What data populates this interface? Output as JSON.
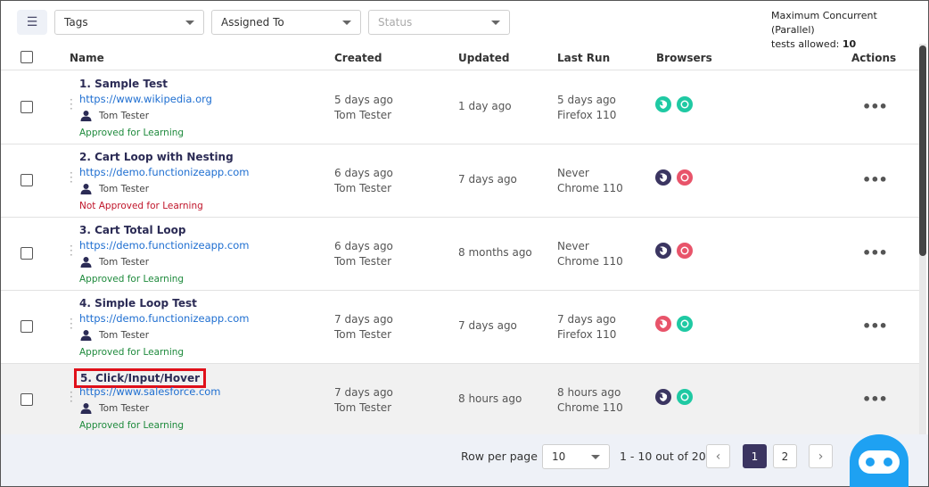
{
  "filters": {
    "tags": "Tags",
    "assigned_to": "Assigned To",
    "status": "Status"
  },
  "max_concurrent": {
    "line1": "Maximum Concurrent (Parallel)",
    "line2_prefix": "tests allowed: ",
    "value": "10"
  },
  "columns": {
    "name": "Name",
    "created": "Created",
    "updated": "Updated",
    "last_run": "Last Run",
    "browsers": "Browsers",
    "actions": "Actions"
  },
  "rows": [
    {
      "name": "1. Sample Test",
      "url": "https://www.wikipedia.org",
      "user": "Tom Tester",
      "status": "Approved for Learning",
      "created": "5 days ago",
      "created_by": "Tom Tester",
      "updated": "1 day ago",
      "last_run": "5 days ago",
      "last_run_browser": "Firefox 110",
      "browsers": [
        "firefox-green-icon",
        "chrome-green-icon"
      ]
    },
    {
      "name": "2. Cart Loop with Nesting",
      "url": "https://demo.functionizeapp.com",
      "user": "Tom Tester",
      "status": "Not Approved for Learning",
      "created": "6 days ago",
      "created_by": "Tom Tester",
      "updated": "7 days ago",
      "last_run": "Never",
      "last_run_browser": "Chrome 110",
      "browsers": [
        "firefox-purple-icon",
        "chrome-red-icon"
      ]
    },
    {
      "name": "3. Cart Total Loop",
      "url": "https://demo.functionizeapp.com",
      "user": "Tom Tester",
      "status": "Approved for Learning",
      "created": "6 days ago",
      "created_by": "Tom Tester",
      "updated": "8 months ago",
      "last_run": "Never",
      "last_run_browser": "Chrome 110",
      "browsers": [
        "firefox-purple-icon",
        "chrome-red-icon"
      ]
    },
    {
      "name": "4. Simple Loop Test",
      "url": "https://demo.functionizeapp.com",
      "user": "Tom Tester",
      "status": "Approved for Learning",
      "created": "7 days ago",
      "created_by": "Tom Tester",
      "updated": "7 days ago",
      "last_run": "7 days ago",
      "last_run_browser": "Firefox 110",
      "browsers": [
        "firefox-red-icon",
        "chrome-green-icon"
      ]
    },
    {
      "name": "5. Click/Input/Hover",
      "url": "https://www.salesforce.com",
      "user": "Tom Tester",
      "status": "Approved for Learning",
      "created": "7 days ago",
      "created_by": "Tom Tester",
      "updated": "8 hours ago",
      "last_run": "8 hours ago",
      "last_run_browser": "Chrome 110",
      "browsers": [
        "firefox-purple-icon",
        "chrome-green-icon"
      ]
    }
  ],
  "colors": {
    "green": "#1fc9a3",
    "red": "#e8546a",
    "purple": "#3b3561",
    "highlight_box": "#e0101a",
    "bot": "#1ea1f2"
  },
  "footer": {
    "rows_per_page_label": "Row per page",
    "rows_per_page": "10",
    "range": "1 - 10 out of 20",
    "pages": [
      "1",
      "2"
    ],
    "current_page": "1"
  }
}
